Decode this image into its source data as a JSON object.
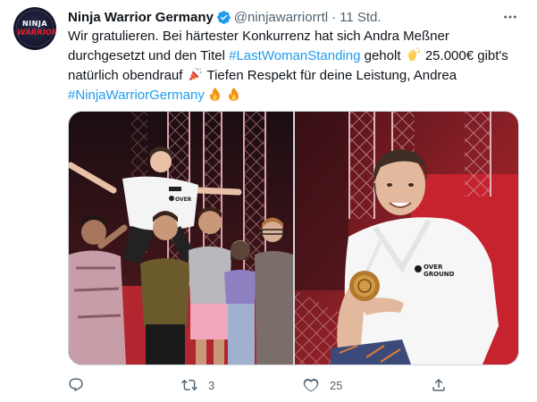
{
  "tweet": {
    "author_name": "Ninja Warrior Germany",
    "author_handle": "@ninjawarriorrtl",
    "separator": "·",
    "time": "11 Std.",
    "avatar": {
      "line1": "NINJA",
      "line2": "WARRIOR"
    },
    "text": {
      "line1": "Wir gratulieren. Bei härtester Konkurrenz hat sich Andra Meßner",
      "line2_a": "durchgesetzt und den Titel ",
      "line2_link": "#LastWomanStanding",
      "line2_b": " geholt ",
      "line2_c": " 25.000€ gibt's",
      "line3_a": "natürlich obendrauf ",
      "line3_b": " Tiefen Respekt für deine Leistung, Andrea",
      "line4_link": "#NinjaWarriorGermany"
    },
    "emoji": [
      "clapping-hands",
      "party-popper",
      "fire",
      "fire"
    ],
    "photo_left_text": {
      "shirt_logo": "OVER"
    },
    "photo_right_text": {
      "shirt_logo_1": "OVER",
      "shirt_logo_2": "GROUND"
    },
    "actions": {
      "reply_count": "",
      "retweet_count": "3",
      "like_count": "25",
      "share_count": ""
    }
  },
  "colors": {
    "text": "#0f1419",
    "secondary": "#536471",
    "link": "#1d9bf0",
    "verified": "#1d9bf0",
    "border": "#cfd9de"
  }
}
